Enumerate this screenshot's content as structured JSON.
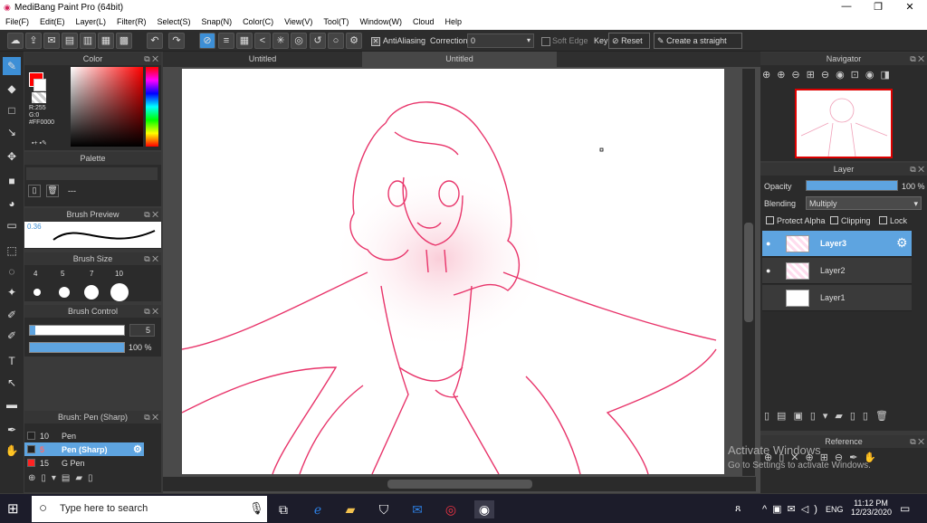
{
  "window": {
    "title": "MediBang Paint Pro (64bit)",
    "min": "—",
    "max": "❐",
    "close": "✕"
  },
  "menu": [
    "File(F)",
    "Edit(E)",
    "Layer(L)",
    "Filter(R)",
    "Select(S)",
    "Snap(N)",
    "Color(C)",
    "View(V)",
    "Tool(T)",
    "Window(W)",
    "Cloud",
    "Help"
  ],
  "toolbar": {
    "antialiasing_label": "AntiAliasing",
    "correction_label": "Correction",
    "correction_value": "0",
    "soft_edge_label": "Soft Edge",
    "key_label": "Key",
    "reset_label": "Reset",
    "straight_line_label": "Create a straight line"
  },
  "tabs": [
    "Untitled",
    "Untitled"
  ],
  "color_panel": {
    "title": "Color",
    "r": "R:255",
    "g": "G:0",
    "b": "B:0",
    "hex": "#FF0000",
    "primary": "#ff0000"
  },
  "palette_panel": {
    "title": "Palette",
    "placeholder": "---"
  },
  "brush_preview": {
    "title": "Brush Preview",
    "size": "0.36"
  },
  "brush_size": {
    "title": "Brush Size",
    "sizes": [
      "4",
      "5",
      "7",
      "10"
    ]
  },
  "brush_control": {
    "title": "Brush Control",
    "size_value": "5",
    "opacity_value": "100 %"
  },
  "brush_list": {
    "title": "Brush: Pen (Sharp)",
    "items": [
      {
        "size": "10",
        "name": "Pen",
        "color": "#222222"
      },
      {
        "size": "5",
        "name": "Pen (Sharp)",
        "color": "#222222"
      },
      {
        "size": "15",
        "name": "G Pen",
        "color": "#ff2222"
      }
    ]
  },
  "navigator": {
    "title": "Navigator"
  },
  "layer_panel": {
    "title": "Layer",
    "opacity_label": "Opacity",
    "opacity_value": "100 %",
    "opacity": 1.0,
    "blending_label": "Blending",
    "blending_value": "Multiply",
    "protect_alpha": "Protect Alpha",
    "clipping": "Clipping",
    "lock": "Lock",
    "layers": [
      "Layer3",
      "Layer2",
      "Layer1"
    ]
  },
  "reference": {
    "title": "Reference"
  },
  "watermark": {
    "line1": "Activate Windows",
    "line2": "Go to Settings to activate Windows."
  },
  "taskbar": {
    "search_placeholder": "Type here to search",
    "time": "11:12 PM",
    "date": "12/23/2020",
    "lang": "ENG"
  },
  "colors": {
    "accent": "#3d8fd6",
    "sketch": "#e8346a"
  }
}
